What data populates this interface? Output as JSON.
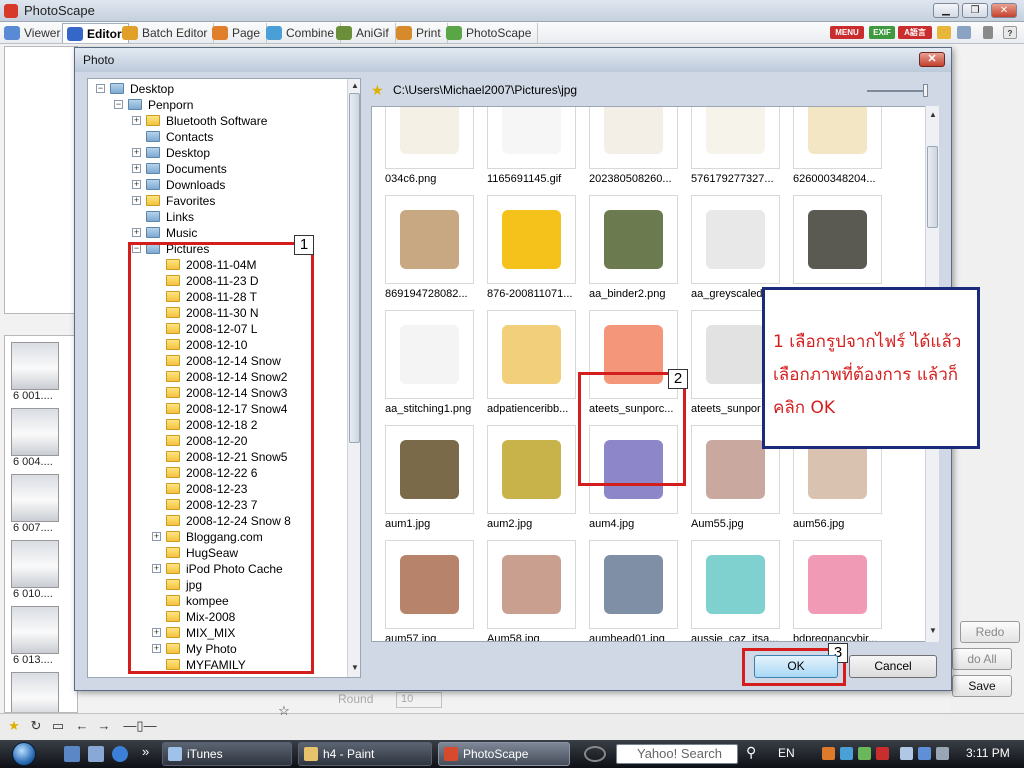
{
  "app": {
    "title": "PhotoScape",
    "window_controls": [
      "▁",
      "❐",
      "✕"
    ],
    "tabs": [
      {
        "label": "Viewer",
        "icon": "viewer-icon",
        "color": "#5a8ad6"
      },
      {
        "label": "Editor",
        "icon": "editor-icon",
        "color": "#3567c9"
      },
      {
        "label": "Batch Editor",
        "icon": "batch-editor-icon",
        "color": "#e0a12b"
      },
      {
        "label": "Page",
        "icon": "page-icon",
        "color": "#e07e2b"
      },
      {
        "label": "Combine",
        "icon": "combine-icon",
        "color": "#4aa0d6"
      },
      {
        "label": "AniGif",
        "icon": "anigif-icon",
        "color": "#6b8e3b"
      },
      {
        "label": "Print",
        "icon": "print-icon",
        "color": "#d68a2b"
      },
      {
        "label": "PhotoScape",
        "icon": "photoscape-icon",
        "color": "#5aa647"
      }
    ],
    "toolbar_badges": [
      "MENU",
      "EXIF",
      "A語言"
    ],
    "thumbnails": [
      "6 001....",
      "6 004....",
      "6 007....",
      "6 010....",
      "6 013...."
    ],
    "right_panel": {
      "redo_label": "Redo",
      "undo_all_label": "do All",
      "save_label": "Save"
    },
    "bottom": {
      "round_label": "Round",
      "round_value": "10"
    }
  },
  "dialog": {
    "title": "Photo",
    "close_label": "✕",
    "path": "C:\\Users\\Michael2007\\Pictures\\jpg",
    "tree": [
      {
        "label": "Desktop",
        "level": 0,
        "expander": "−",
        "kind": "sys"
      },
      {
        "label": "Penporn",
        "level": 1,
        "expander": "−",
        "kind": "sys"
      },
      {
        "label": "Bluetooth Software",
        "level": 2,
        "expander": "+",
        "kind": "folder"
      },
      {
        "label": "Contacts",
        "level": 2,
        "expander": "",
        "kind": "sys"
      },
      {
        "label": "Desktop",
        "level": 2,
        "expander": "+",
        "kind": "sys"
      },
      {
        "label": "Documents",
        "level": 2,
        "expander": "+",
        "kind": "sys"
      },
      {
        "label": "Downloads",
        "level": 2,
        "expander": "+",
        "kind": "sys"
      },
      {
        "label": "Favorites",
        "level": 2,
        "expander": "+",
        "kind": "folder"
      },
      {
        "label": "Links",
        "level": 2,
        "expander": "",
        "kind": "sys"
      },
      {
        "label": "Music",
        "level": 2,
        "expander": "+",
        "kind": "sys"
      },
      {
        "label": "Pictures",
        "level": 2,
        "expander": "−",
        "kind": "sys"
      },
      {
        "label": "2008-11-04M",
        "level": 3,
        "expander": "",
        "kind": "folder"
      },
      {
        "label": "2008-11-23 D",
        "level": 3,
        "expander": "",
        "kind": "folder"
      },
      {
        "label": "2008-11-28 T",
        "level": 3,
        "expander": "",
        "kind": "folder"
      },
      {
        "label": "2008-11-30 N",
        "level": 3,
        "expander": "",
        "kind": "folder"
      },
      {
        "label": "2008-12-07 L",
        "level": 3,
        "expander": "",
        "kind": "folder"
      },
      {
        "label": "2008-12-10",
        "level": 3,
        "expander": "",
        "kind": "folder"
      },
      {
        "label": "2008-12-14 Snow",
        "level": 3,
        "expander": "",
        "kind": "folder"
      },
      {
        "label": "2008-12-14 Snow2",
        "level": 3,
        "expander": "",
        "kind": "folder"
      },
      {
        "label": "2008-12-14 Snow3",
        "level": 3,
        "expander": "",
        "kind": "folder"
      },
      {
        "label": "2008-12-17 Snow4",
        "level": 3,
        "expander": "",
        "kind": "folder"
      },
      {
        "label": "2008-12-18 2",
        "level": 3,
        "expander": "",
        "kind": "folder"
      },
      {
        "label": "2008-12-20",
        "level": 3,
        "expander": "",
        "kind": "folder"
      },
      {
        "label": "2008-12-21 Snow5",
        "level": 3,
        "expander": "",
        "kind": "folder"
      },
      {
        "label": "2008-12-22 6",
        "level": 3,
        "expander": "",
        "kind": "folder"
      },
      {
        "label": "2008-12-23",
        "level": 3,
        "expander": "",
        "kind": "folder"
      },
      {
        "label": "2008-12-23 7",
        "level": 3,
        "expander": "",
        "kind": "folder"
      },
      {
        "label": "2008-12-24 Snow 8",
        "level": 3,
        "expander": "",
        "kind": "folder"
      },
      {
        "label": "Bloggang.com",
        "level": 3,
        "expander": "+",
        "kind": "folder"
      },
      {
        "label": "HugSeaw",
        "level": 3,
        "expander": "",
        "kind": "folder"
      },
      {
        "label": "iPod Photo Cache",
        "level": 3,
        "expander": "+",
        "kind": "folder"
      },
      {
        "label": "jpg",
        "level": 3,
        "expander": "",
        "kind": "folder"
      },
      {
        "label": "kompee",
        "level": 3,
        "expander": "",
        "kind": "folder"
      },
      {
        "label": "Mix-2008",
        "level": 3,
        "expander": "",
        "kind": "folder"
      },
      {
        "label": "MIX_MIX",
        "level": 3,
        "expander": "+",
        "kind": "folder"
      },
      {
        "label": "My Photo",
        "level": 3,
        "expander": "+",
        "kind": "folder"
      },
      {
        "label": "MYFAMILY",
        "level": 3,
        "expander": "",
        "kind": "folder"
      }
    ],
    "files": [
      {
        "name": "034c6.png",
        "color": "#f4f0e6"
      },
      {
        "name": "1165691145.gif",
        "color": "#f6f6f6"
      },
      {
        "name": "202380508260...",
        "color": "#f4efe6"
      },
      {
        "name": "576179277327...",
        "color": "#f6f3ea"
      },
      {
        "name": "626000348204...",
        "color": "#f2e6c4"
      },
      {
        "name": "869194728082...",
        "color": "#c8a882"
      },
      {
        "name": "876-200811071...",
        "color": "#f5c21b"
      },
      {
        "name": "aa_binder2.png",
        "color": "#6c7a4f"
      },
      {
        "name": "aa_greyscaledc...",
        "color": "#e8e8e8"
      },
      {
        "name": "aa_stickpin.png",
        "color": "#5b5a52"
      },
      {
        "name": "aa_stitching1.png",
        "color": "#f4f4f4"
      },
      {
        "name": "adpatienceribb...",
        "color": "#f2cf7a"
      },
      {
        "name": "ateets_sunporc...",
        "color": "#f4967a"
      },
      {
        "name": "ateets_sunpor",
        "color": "#e2e2e2"
      },
      {
        "name": "",
        "color": "#f2e8d2"
      },
      {
        "name": "aum1.jpg",
        "color": "#7a6a4a"
      },
      {
        "name": "aum2.jpg",
        "color": "#c7b34a"
      },
      {
        "name": "aum4.jpg",
        "color": "#8d86c8"
      },
      {
        "name": "Aum55.jpg",
        "color": "#c9a8a0"
      },
      {
        "name": "aum56.jpg",
        "color": "#d9c3b0"
      },
      {
        "name": "aum57.jpg",
        "color": "#b8836b"
      },
      {
        "name": "Aum58.jpg",
        "color": "#c9a08f"
      },
      {
        "name": "aumhead01.jpg",
        "color": "#7f8fa6"
      },
      {
        "name": "aussie_caz_itsa...",
        "color": "#7fd1cf"
      },
      {
        "name": "bdpregnancybir...",
        "color": "#f09ab6"
      },
      {
        "name": "",
        "color": "#d2566a"
      },
      {
        "name": "",
        "color": "#f6f6f6"
      },
      {
        "name": "",
        "color": "#e8e0cc"
      },
      {
        "name": "",
        "color": "#f6f6f6"
      },
      {
        "name": "",
        "color": "#f6f6f6"
      }
    ],
    "annotations": {
      "tree_tag": "1",
      "file_tag": "2",
      "ok_tag": "3"
    },
    "callout_lines": [
      "1 เลือกรูปจากไฟร์ ได้แล้ว",
      "เลือกภาพที่ต้องการ แล้วก็",
      "คลิก  OK"
    ],
    "ok_label": "OK",
    "cancel_label": "Cancel"
  },
  "taskbar": {
    "tasks": [
      {
        "label": "iTunes",
        "color": "#9fc3e8"
      },
      {
        "label": "h4 - Paint",
        "color": "#e7c36b"
      },
      {
        "label": "PhotoScape",
        "color": "#d84a2e"
      }
    ],
    "search_placeholder": "Yahoo! Search",
    "language": "EN",
    "clock": "3:11 PM"
  }
}
